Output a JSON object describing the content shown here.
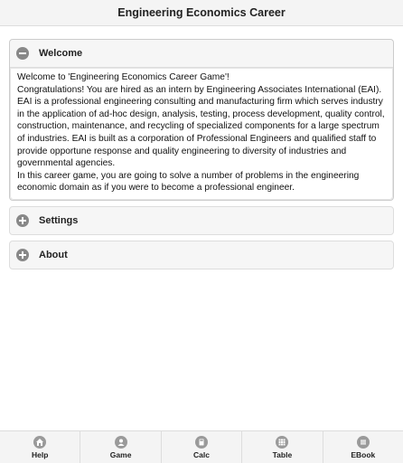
{
  "header": {
    "title": "Engineering Economics Career"
  },
  "sections": {
    "welcome": {
      "label": "Welcome",
      "lines": [
        "Welcome to 'Engineering Economics Career Game'!",
        "Congratulations! You are hired as an intern by Engineering Associates International (EAI). EAI is a professional engineering consulting and manufacturing firm which serves industry in the application of ad-hoc design, analysis, testing, process development, quality control, construction, maintenance, and recycling of specialized components for a large spectrum of industries. EAI is built as a corporation of Professional Engineers and qualified staff to provide opportune response and quality engineering to diversity of industries and governmental agencies.",
        "In this career game, you are going to solve a number of problems in the engineering economic domain as if you were to become a professional engineer."
      ]
    },
    "settings": {
      "label": "Settings"
    },
    "about": {
      "label": "About"
    }
  },
  "navbar": {
    "items": [
      {
        "label": "Help",
        "icon": "home-icon"
      },
      {
        "label": "Game",
        "icon": "user-icon"
      },
      {
        "label": "Calc",
        "icon": "calculator-icon"
      },
      {
        "label": "Table",
        "icon": "grid-icon"
      },
      {
        "label": "EBook",
        "icon": "book-icon"
      }
    ]
  }
}
